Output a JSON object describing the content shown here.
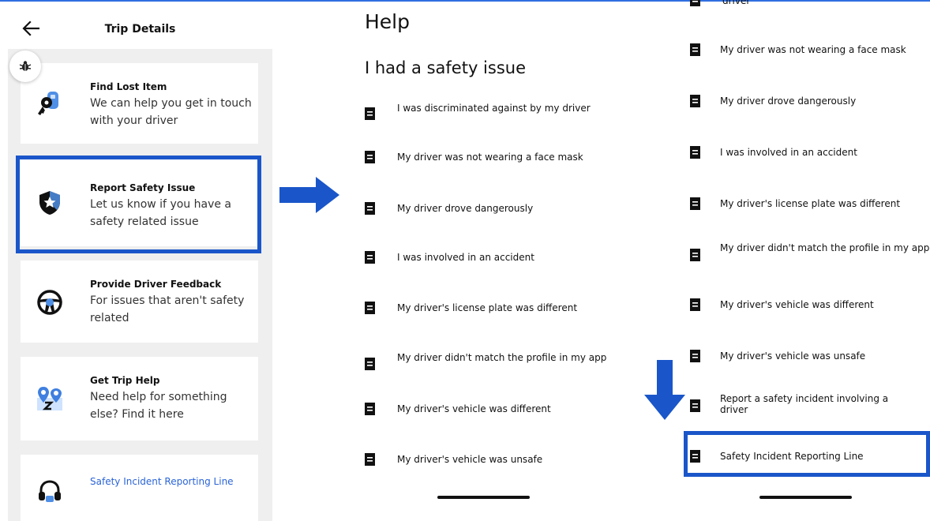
{
  "colors": {
    "highlight": "#1a56c9",
    "link": "#2a64d8",
    "panel_bg": "#efefef"
  },
  "trip_details": {
    "title": "Trip Details",
    "cards": [
      {
        "title": "Find Lost Item",
        "desc": "We can help you get in touch with your driver",
        "icon": "keys-icon"
      },
      {
        "title": "Report Safety Issue",
        "desc": "Let us know if you have a safety related issue",
        "icon": "shield-star-icon"
      },
      {
        "title": "Provide Driver Feedback",
        "desc": "For issues that aren't safety related",
        "icon": "steering-wheel-icon"
      },
      {
        "title": "Get Trip Help",
        "desc": "Need help for something else? Find it here",
        "icon": "map-pins-icon"
      },
      {
        "title": "Safety Incident Reporting Line",
        "icon": "headset-icon"
      }
    ]
  },
  "help": {
    "title": "Help",
    "heading": "I had a safety issue",
    "items": [
      "I was discriminated against by my driver",
      "My driver was not wearing a face mask",
      "My driver drove dangerously",
      "I was involved in an accident",
      "My driver's license plate was different",
      "My driver didn't match the profile in my app",
      "My driver's vehicle was different",
      "My driver's vehicle was unsafe"
    ]
  },
  "help_scrolled": {
    "partial_top": "driver",
    "items": [
      "My driver was not wearing a face mask",
      "My driver drove dangerously",
      "I was involved in an accident",
      "My driver's license plate was different",
      "My driver didn't match the profile in my app",
      "My driver's vehicle was different",
      "My driver's vehicle was unsafe",
      "Report a safety incident involving a driver",
      "Safety Incident Reporting Line"
    ]
  }
}
